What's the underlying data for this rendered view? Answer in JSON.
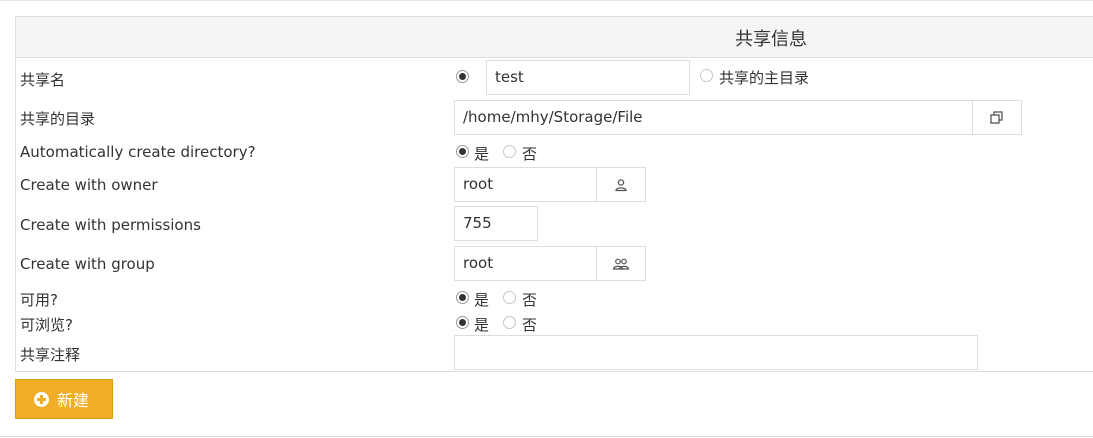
{
  "header": {
    "title": "共享信息"
  },
  "form": {
    "share_name": {
      "label": "共享名",
      "value": "test",
      "alt_option_label": "共享的主目录"
    },
    "share_dir": {
      "label": "共享的目录",
      "value": "/home/mhy/Storage/File"
    },
    "auto_create": {
      "label": "Automatically create directory?",
      "yes": "是",
      "no": "否",
      "selected": "yes"
    },
    "owner": {
      "label": "Create with owner",
      "value": "root"
    },
    "permissions": {
      "label": "Create with permissions",
      "value": "755"
    },
    "group": {
      "label": "Create with group",
      "value": "root"
    },
    "available": {
      "label": "可用?",
      "yes": "是",
      "no": "否",
      "selected": "yes"
    },
    "browsable": {
      "label": "可浏览?",
      "yes": "是",
      "no": "否",
      "selected": "yes"
    },
    "comment": {
      "label": "共享注释",
      "value": ""
    }
  },
  "actions": {
    "new_label": "新建"
  },
  "colors": {
    "accent": "#f0ad27",
    "border": "#dddddd",
    "header_bg": "#f5f5f5"
  }
}
